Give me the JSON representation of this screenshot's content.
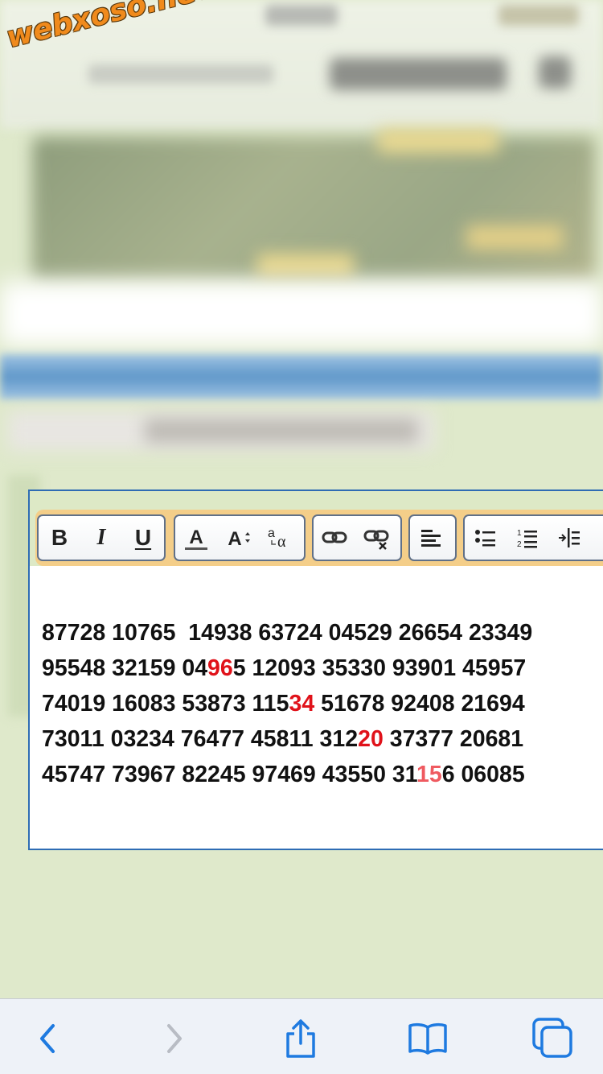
{
  "watermark": "webxoso.net",
  "toolbar": {
    "groups": [
      {
        "name": "text-style",
        "buttons": [
          {
            "name": "bold-button",
            "label": "B"
          },
          {
            "name": "italic-button",
            "label": "I"
          },
          {
            "name": "underline-button",
            "label": "U"
          }
        ]
      },
      {
        "name": "font",
        "buttons": [
          {
            "name": "font-color-button",
            "label": "A"
          },
          {
            "name": "font-size-button",
            "label": "A"
          },
          {
            "name": "font-case-button",
            "label": "aα"
          }
        ]
      },
      {
        "name": "links",
        "buttons": [
          {
            "name": "insert-link-button",
            "icon": "link-icon"
          },
          {
            "name": "remove-link-button",
            "icon": "unlink-icon"
          }
        ]
      },
      {
        "name": "align",
        "buttons": [
          {
            "name": "align-button",
            "icon": "align-left-icon"
          }
        ]
      },
      {
        "name": "lists",
        "buttons": [
          {
            "name": "bullet-list-button",
            "icon": "bullet-list-icon"
          },
          {
            "name": "numbered-list-button",
            "icon": "numbered-list-icon"
          },
          {
            "name": "indent-button",
            "icon": "indent-icon"
          }
        ]
      }
    ]
  },
  "editor": {
    "lines": [
      [
        {
          "t": "87728 10765  14938 63724 04529 26654 23349"
        }
      ],
      [
        {
          "t": "95548 32159 04"
        },
        {
          "t": "96",
          "h": "red"
        },
        {
          "t": "5 12093 35330 93901 45957"
        }
      ],
      [
        {
          "t": "74019 16083 53873 115"
        },
        {
          "t": "34",
          "h": "red"
        },
        {
          "t": " 51678 92408 21694"
        }
      ],
      [
        {
          "t": "73011 03234 76477 45811 312"
        },
        {
          "t": "20",
          "h": "red"
        },
        {
          "t": " 37377 20681"
        }
      ],
      [
        {
          "t": "45747 73967 82245 97469 43550 31"
        },
        {
          "t": "15",
          "h": "light"
        },
        {
          "t": "6 06085"
        }
      ]
    ]
  },
  "bottom_bar": {
    "buttons": [
      "back-icon",
      "forward-icon",
      "share-icon",
      "bookmarks-icon",
      "tabs-icon"
    ]
  },
  "colors": {
    "background": "#dfe9cb",
    "toolbar": "#f4ce89",
    "highlight": "#e0121a",
    "accent": "#1e7ae0"
  }
}
